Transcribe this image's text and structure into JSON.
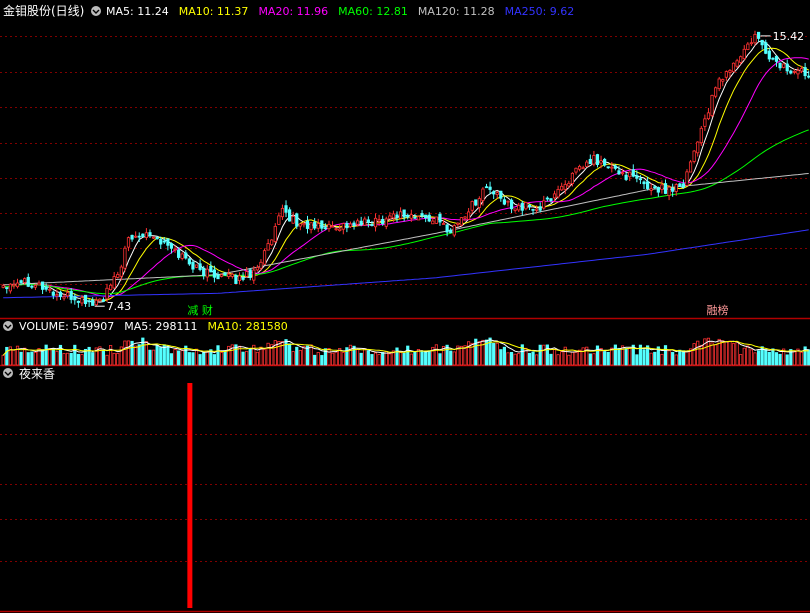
{
  "header": {
    "title": "金钼股份(日线)",
    "indicators": [
      {
        "label": "MA5: 11.24",
        "color": "#ffffff"
      },
      {
        "label": "MA10: 11.37",
        "color": "#ffff00"
      },
      {
        "label": "MA20: 11.96",
        "color": "#ff00ff"
      },
      {
        "label": "MA60: 12.81",
        "color": "#00ff00"
      },
      {
        "label": "MA120: 11.28",
        "color": "#c0c0c0"
      },
      {
        "label": "MA250: 9.62",
        "color": "#3333ff"
      }
    ]
  },
  "price_panel": {
    "high_label": "15.42",
    "low_label": "7.43",
    "event_tags": [
      {
        "label": "减 财",
        "color": "#00ff00",
        "index": 52
      },
      {
        "label": "融榜",
        "color": "#ff9999",
        "index": 197
      }
    ]
  },
  "volume_panel": {
    "labels": [
      {
        "label": "VOLUME: 549907",
        "color": "#ffffff"
      },
      {
        "label": "MA5: 298111",
        "color": "#ffffff"
      },
      {
        "label": "MA10: 281580",
        "color": "#ffff00"
      }
    ]
  },
  "indicator_panel": {
    "title": "夜来香",
    "signal_index": 52
  },
  "colors": {
    "background": "#000000",
    "grid": "#800000",
    "separator": "#b00000",
    "up": "#ff3232",
    "down": "#54ffff",
    "signal": "#ff0000",
    "ma5": "#ffffff",
    "ma10": "#ffff00",
    "ma20": "#ff00ff",
    "ma60": "#00ff00",
    "ma120": "#c0c0c0",
    "ma250": "#3333ff"
  },
  "chart_data": {
    "type": "candlestick",
    "y_range": [
      7.2,
      15.8
    ],
    "price_anchors": [
      [
        0,
        8.0
      ],
      [
        5,
        8.15
      ],
      [
        10,
        8.0
      ],
      [
        15,
        7.7
      ],
      [
        20,
        7.6
      ],
      [
        25,
        7.45
      ],
      [
        28,
        7.6
      ],
      [
        32,
        8.3
      ],
      [
        35,
        9.3
      ],
      [
        40,
        9.6
      ],
      [
        45,
        9.2
      ],
      [
        50,
        8.85
      ],
      [
        55,
        8.4
      ],
      [
        60,
        8.3
      ],
      [
        65,
        8.15
      ],
      [
        70,
        8.4
      ],
      [
        75,
        9.3
      ],
      [
        78,
        10.2
      ],
      [
        82,
        9.8
      ],
      [
        88,
        9.7
      ],
      [
        95,
        9.75
      ],
      [
        100,
        9.8
      ],
      [
        105,
        9.9
      ],
      [
        110,
        10.1
      ],
      [
        115,
        10.0
      ],
      [
        120,
        9.95
      ],
      [
        125,
        9.6
      ],
      [
        130,
        10.2
      ],
      [
        135,
        10.9
      ],
      [
        140,
        10.4
      ],
      [
        145,
        10.3
      ],
      [
        150,
        10.25
      ],
      [
        155,
        10.8
      ],
      [
        160,
        11.3
      ],
      [
        165,
        11.7
      ],
      [
        170,
        11.4
      ],
      [
        175,
        11.2
      ],
      [
        180,
        10.9
      ],
      [
        185,
        10.8
      ],
      [
        190,
        11.0
      ],
      [
        195,
        12.6
      ],
      [
        200,
        14.0
      ],
      [
        205,
        14.6
      ],
      [
        210,
        15.3
      ],
      [
        215,
        14.6
      ],
      [
        220,
        14.3
      ],
      [
        225,
        14.25
      ]
    ],
    "ma120_anchors": [
      [
        0,
        8.0
      ],
      [
        60,
        8.3
      ],
      [
        120,
        9.5
      ],
      [
        180,
        10.8
      ],
      [
        225,
        11.28
      ]
    ],
    "ma250_anchors": [
      [
        0,
        7.62
      ],
      [
        60,
        7.75
      ],
      [
        120,
        8.2
      ],
      [
        180,
        8.9
      ],
      [
        225,
        9.62
      ]
    ]
  }
}
